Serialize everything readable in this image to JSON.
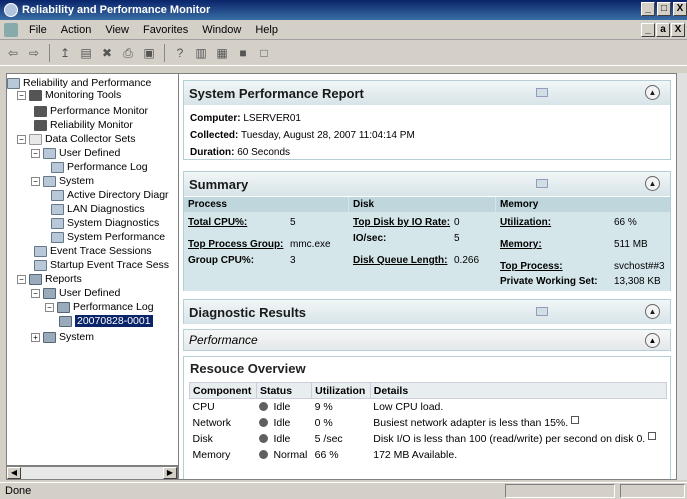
{
  "window": {
    "title": "Reliability and Performance Monitor",
    "controls": [
      "_",
      "□",
      "X"
    ]
  },
  "menubar": {
    "items": [
      "File",
      "Action",
      "View",
      "Favorites",
      "Window",
      "Help"
    ],
    "mdi_controls": [
      "_",
      "a",
      "X"
    ]
  },
  "toolbar": {
    "icons": [
      "back-icon",
      "forward-icon",
      "up-icon",
      "show-hide-tree-icon",
      "delete-icon",
      "print-icon",
      "refresh-icon",
      "help-icon",
      "properties-icon",
      "chart-icon",
      "report-icon",
      "new-window-icon"
    ]
  },
  "tree": {
    "items": [
      {
        "label": "Reliability and Performance",
        "icon": "performance-icon",
        "expander": ""
      },
      {
        "label": "Monitoring Tools",
        "icon": "monitor-icon",
        "expander": "−"
      },
      {
        "label": "Performance Monitor",
        "icon": "perfmon-icon",
        "expander": ""
      },
      {
        "label": "Reliability Monitor",
        "icon": "perfmon-icon",
        "expander": ""
      },
      {
        "label": "Data Collector Sets",
        "icon": "folder-icon",
        "expander": "−"
      },
      {
        "label": "User Defined",
        "icon": "collector-set-icon",
        "expander": "−"
      },
      {
        "label": "Performance Log",
        "icon": "collector-icon",
        "expander": ""
      },
      {
        "label": "System",
        "icon": "collector-set-icon",
        "expander": "−"
      },
      {
        "label": "Active Directory Diagr",
        "icon": "collector-icon",
        "expander": ""
      },
      {
        "label": "LAN Diagnostics",
        "icon": "collector-icon",
        "expander": ""
      },
      {
        "label": "System Diagnostics",
        "icon": "collector-icon",
        "expander": ""
      },
      {
        "label": "System Performance",
        "icon": "collector-icon",
        "expander": ""
      },
      {
        "label": "Event Trace Sessions",
        "icon": "collector-icon",
        "expander": ""
      },
      {
        "label": "Startup Event Trace Sess",
        "icon": "collector-icon",
        "expander": ""
      },
      {
        "label": "Reports",
        "icon": "reports-icon",
        "expander": "−"
      },
      {
        "label": "User Defined",
        "icon": "reports-icon",
        "expander": "−"
      },
      {
        "label": "Performance Log",
        "icon": "reports-icon",
        "expander": "−"
      },
      {
        "label": "20070828-0001",
        "icon": "report-icon",
        "expander": "",
        "selected": true
      },
      {
        "label": "System",
        "icon": "reports-icon",
        "expander": "+"
      }
    ]
  },
  "report": {
    "title": "System Performance Report",
    "computer_label": "Computer:",
    "computer": "LSERVER01",
    "collected_label": "Collected:",
    "collected": "Tuesday, August 28, 2007 11:04:14 PM",
    "duration_label": "Duration:",
    "duration": "60 Seconds"
  },
  "summary": {
    "title": "Summary",
    "process": {
      "header": "Process",
      "total_cpu_label": "Total CPU%:",
      "total_cpu": "5",
      "top_process_group_label": "Top Process Group:",
      "top_process_group": "mmc.exe",
      "group_cpu_label": "Group CPU%:",
      "group_cpu": "3"
    },
    "disk": {
      "header": "Disk",
      "top_disk_label": "Top Disk by IO Rate:",
      "top_disk": "0",
      "io_sec_label": "IO/sec:",
      "io_sec": "5",
      "queue_label": "Disk Queue Length:",
      "queue": "0.266"
    },
    "memory": {
      "header": "Memory",
      "utilization_label": "Utilization:",
      "utilization": "66 %",
      "memory_label": "Memory:",
      "memory": "511 MB",
      "top_process_label": "Top Process:",
      "top_process": "svchost##3",
      "pws_label": "Private Working Set:",
      "pws": "13,308 KB"
    }
  },
  "diagnostic": {
    "title": "Diagnostic Results",
    "performance_label": "Performance"
  },
  "resource_overview": {
    "title": "Resouce Overview",
    "columns": [
      "Component",
      "Status",
      "Utilization",
      "Details"
    ],
    "rows": [
      {
        "component": "CPU",
        "status": "Idle",
        "utilization": "9 %",
        "details": "Low CPU load.",
        "note": false
      },
      {
        "component": "Network",
        "status": "Idle",
        "utilization": "0 %",
        "details": "Busiest network adapter is less than 15%.",
        "note": true
      },
      {
        "component": "Disk",
        "status": "Idle",
        "utilization": "5 /sec",
        "details": "Disk I/O is less than 100 (read/write) per second on disk 0.",
        "note": true
      },
      {
        "component": "Memory",
        "status": "Normal",
        "utilization": "66 %",
        "details": "172 MB Available.",
        "note": false
      }
    ]
  },
  "statusbar": {
    "text": "Done"
  }
}
